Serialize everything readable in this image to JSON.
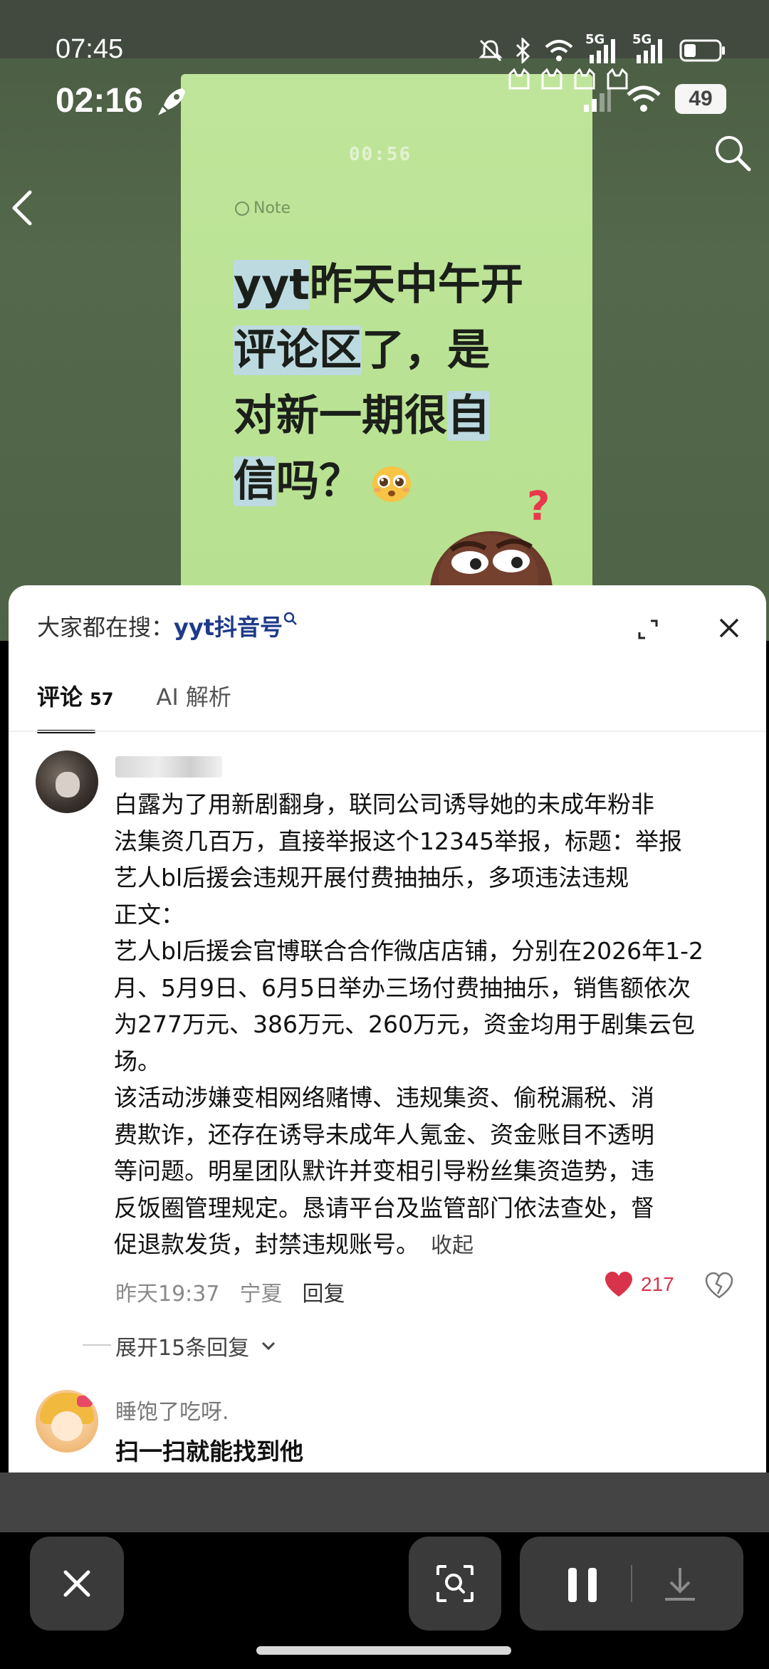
{
  "status": {
    "time_primary": "07:45",
    "time_secondary": "02:16",
    "battery": "49",
    "network_a": "5G",
    "network_b": "5G"
  },
  "note": {
    "timer": "00:56",
    "tag": "Note",
    "title_lines": [
      "yyt昨天中午开",
      "评论区了，是",
      "对新一期很自",
      "信吗？"
    ],
    "title_hl_1": "yyt",
    "title_rest_1": "昨天中午开",
    "title_hl_2": "评论区",
    "title_rest_2": "了，是",
    "title_rest_3": "对新一期很",
    "title_hl_3": "自",
    "title_hl_4": "信",
    "title_rest_4": "吗？"
  },
  "panel": {
    "search_prefix": "大家都在搜：",
    "search_keyword": "yyt抖音号",
    "tabs": {
      "comments_label": "评论",
      "comments_count": "57",
      "ai_label": "AI 解析"
    },
    "comment1": {
      "text": "白露为了用新剧翻身，联同公司诱导她的未成年粉非\n法集资几百万，直接举报这个12345举报，标题：举报\n艺人bl后援会违规开展付费抽抽乐，多项违法违规\n 正文：\n艺人bl后援会官博联合合作微店店铺，分别在2026年1-2\n月、5月9日、6月5日举办三场付费抽抽乐，销售额依次\n为277万元、386万元、260万元，资金均用于剧集云包\n场。\n该活动涉嫌变相网络赌博、违规集资、偷税漏税、消\n费欺诈，还存在诱导未成年人氪金、资金账目不透明\n等问题。明星团队默许并变相引导粉丝集资造势，违\n反饭圈管理规定。恳请平台及监管部门依法查处，督\n促退款发货，封禁违规账号。",
      "collapse": "收起",
      "time": "昨天19:37",
      "location": "宁夏",
      "reply": "回复",
      "likes": "217",
      "expand_replies": "展开15条回复"
    },
    "comment2": {
      "user": "睡饱了吃呀.",
      "text": "扫一扫就能找到他"
    }
  },
  "colors": {
    "like": "#d8334a",
    "search_keyword": "#1e3a8a",
    "note_bg": "#bfe59a"
  },
  "icons": [
    "rocket-icon",
    "back-icon",
    "search-icon",
    "expand-icon",
    "close-icon",
    "heart-icon",
    "broken-heart-icon",
    "chevron-down-icon",
    "scan-icon",
    "pause-icon",
    "download-icon"
  ]
}
